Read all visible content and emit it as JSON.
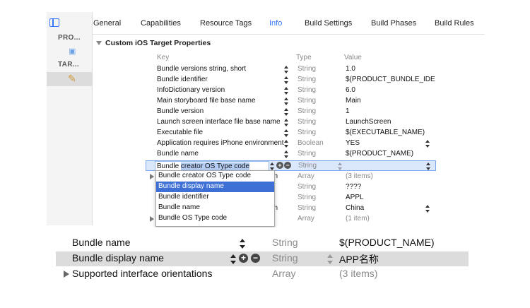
{
  "sidebar": {
    "project_header": "PRO...",
    "targets_header": "TAR..."
  },
  "tabs": [
    {
      "label": "General"
    },
    {
      "label": "Capabilities"
    },
    {
      "label": "Resource Tags"
    },
    {
      "label": "Info"
    },
    {
      "label": "Build Settings"
    },
    {
      "label": "Build Phases"
    },
    {
      "label": "Build Rules"
    }
  ],
  "active_tab": "Info",
  "section_title": "Custom iOS Target Properties",
  "table": {
    "headers": {
      "key": "Key",
      "type": "Type",
      "value": "Value"
    },
    "rows": [
      {
        "key": "Bundle versions string, short",
        "type": "String",
        "value": "1.0"
      },
      {
        "key": "Bundle identifier",
        "type": "String",
        "value": "$(PRODUCT_BUNDLE_IDEN"
      },
      {
        "key": "InfoDictionary version",
        "type": "String",
        "value": "6.0"
      },
      {
        "key": "Main storyboard file base name",
        "type": "String",
        "value": "Main"
      },
      {
        "key": "Bundle version",
        "type": "String",
        "value": "1"
      },
      {
        "key": "Launch screen interface file base name",
        "type": "String",
        "value": "LaunchScreen"
      },
      {
        "key": "Executable file",
        "type": "String",
        "value": "$(EXECUTABLE_NAME)"
      },
      {
        "key": "Application requires iPhone environment",
        "type": "Boolean",
        "value": "YES"
      },
      {
        "key": "Bundle name",
        "type": "String",
        "value": "$(PRODUCT_NAME)"
      }
    ],
    "editing_row": {
      "prefix": "Bundle ",
      "selected": "creator OS Type code",
      "type": "String"
    },
    "hidden_rows": [
      {
        "key_tail": "on",
        "type": "Array",
        "value": "(3 items)"
      },
      {
        "key_tail": "",
        "type": "String",
        "value": "????"
      },
      {
        "key_tail": "",
        "type": "String",
        "value": "APPL"
      },
      {
        "key_tail": "on",
        "type": "String",
        "value": "China"
      },
      {
        "key_tail": "",
        "type": "Array",
        "value": "(1 item)"
      }
    ]
  },
  "dropdown": {
    "items": [
      "Bundle creator OS Type code",
      "Bundle display name",
      "Bundle identifier",
      "Bundle name",
      "Bundle OS Type code"
    ],
    "selected_index": 1
  },
  "zoom": {
    "rows": [
      {
        "key": "Bundle name",
        "type": "String",
        "value": "$(PRODUCT_NAME)"
      },
      {
        "key": "Bundle display name",
        "type": "String",
        "value": "APP名称"
      },
      {
        "key": "Supported interface orientations",
        "type": "Array",
        "value": "(3 items)"
      }
    ]
  }
}
